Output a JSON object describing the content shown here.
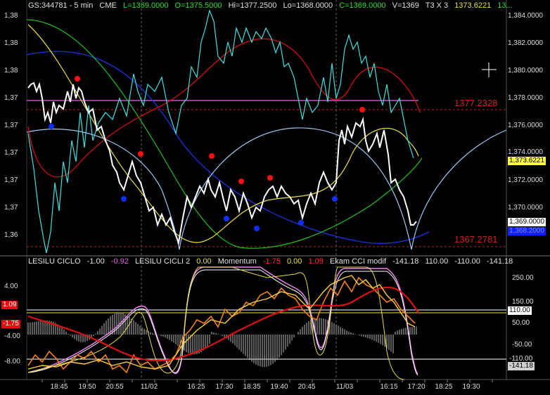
{
  "header": {
    "symbol": "GS:344781 - 5 min",
    "exchange": "CME",
    "last": "L=1369.0000",
    "open": "O=1375.5000",
    "high": "Hi=1377.2500",
    "low": "Lo=1368.0000",
    "close": "C=1369.0000",
    "volume": "V=1369",
    "mode": "T3 X 3",
    "value1": "1373.6221",
    "value2": "13..."
  },
  "price_axis": {
    "right_ticks": [
      "1,384.0000",
      "1,382.0000",
      "1,380.0000",
      "1,378.0000",
      "1,376.0000",
      "1,374.0000",
      "1,372.0000",
      "1,370.0000"
    ],
    "left_ticks": [
      "1,38",
      "1,38",
      "1,38",
      "1,37",
      "1,37",
      "1,37",
      "1,37",
      "1,37",
      "1,36"
    ],
    "tag_yellow": "1,373.6221",
    "tag_last": "1,369.0000",
    "tag_blue": "1,368.2000"
  },
  "levels": {
    "upper": "1377.2328",
    "lower": "1367.2781"
  },
  "indicators": {
    "ciclo_name": "LESILU CICLO",
    "ciclo_val": "-1.00",
    "ciclo_val2": "-0.92",
    "cicli2_name": "LESILU CICLI 2",
    "cicli2_val": "0.00",
    "momentum_name": "Momentum",
    "momentum_val": "-1.75",
    "momentum_val2": "0.00",
    "momentum_val3": "1.09",
    "cci_name": "Ekam CCI modif",
    "cci_val": "-141.18",
    "cci_val2": "110.00",
    "cci_val3": "-110.00",
    "cci_val4": "-141.18"
  },
  "lower_axis": {
    "left_ticks": [
      "4.00",
      "-4.00",
      "-8.00"
    ],
    "left_tag1": "1.09",
    "left_tag2": "-1.75",
    "right_ticks": [
      "250.00",
      "150.00",
      "50.00",
      "-50.00"
    ],
    "right_tag_110": "110.00",
    "right_tag_m110": "-110.00",
    "right_tag_last": "-141.18"
  },
  "time_axis": [
    "18:45",
    "19:50",
    "20:55",
    "11/02",
    "16:25",
    "17:30",
    "18:35",
    "19:40",
    "20:45",
    "11/03",
    "16:15",
    "17:20",
    "18:25",
    "19:30"
  ],
  "colors": {
    "price": "#ffffff",
    "cyan": "#40e0e0",
    "red_line": "#d01010",
    "green_line": "#20c020",
    "blue_line": "#2030e0",
    "yellow_line": "#e8e040",
    "level_magenta": "#e040e0",
    "dot_red": "#ff1010",
    "dot_blue": "#1030ff"
  }
}
